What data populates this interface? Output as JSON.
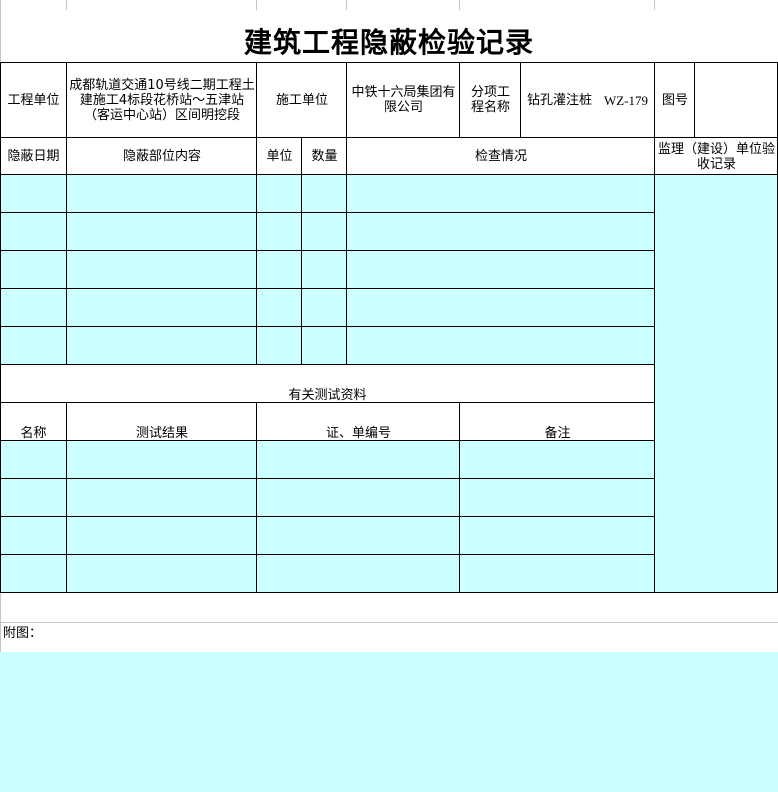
{
  "title": "建筑工程隐蔽检验记录",
  "header": {
    "project_unit_label": "工程单位",
    "project_unit_value": "成都轨道交通10号线二期工程土建施工4标段花桥站～五津站（客运中心站）区间明挖段",
    "construction_unit_label": "施工单位",
    "construction_unit_value": "中铁十六局集团有限公司",
    "sub_project_label": "分项工程名称",
    "sub_project_value": "钻孔灌注桩",
    "code": "WZ-179",
    "drawing_no_label": "图号",
    "drawing_no_value": ""
  },
  "table": {
    "columns": [
      "隐蔽日期",
      "隐蔽部位内容",
      "单位",
      "数量",
      "检查情况"
    ],
    "supervision_label": "监理（建设）单位验收记录",
    "rows": [
      [
        "",
        "",
        "",
        "",
        ""
      ],
      [
        "",
        "",
        "",
        "",
        ""
      ],
      [
        "",
        "",
        "",
        "",
        ""
      ],
      [
        "",
        "",
        "",
        "",
        ""
      ],
      [
        "",
        "",
        "",
        "",
        ""
      ]
    ]
  },
  "test_section": {
    "title": "有关测试资料",
    "columns": [
      "名称",
      "测试结果",
      "证、单编号",
      "备注"
    ],
    "rows": [
      [
        "",
        "",
        "",
        ""
      ],
      [
        "",
        "",
        "",
        ""
      ],
      [
        "",
        "",
        "",
        ""
      ],
      [
        "",
        "",
        "",
        ""
      ]
    ]
  },
  "attachment_label": "附图：",
  "colors": {
    "fill": "#ccffff",
    "grid": "#c6c6c6",
    "border": "#000000"
  }
}
